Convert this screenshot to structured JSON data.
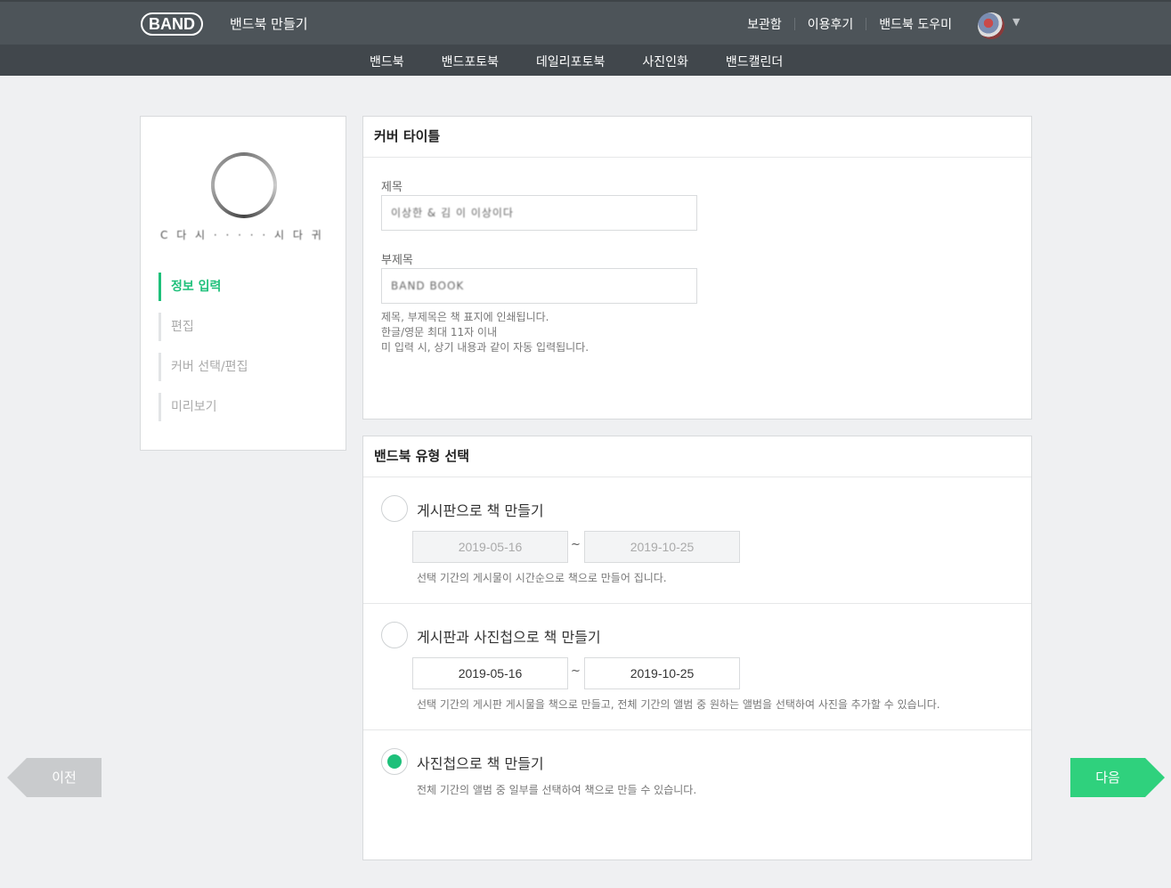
{
  "header": {
    "logo_text": "BAND",
    "app_title": "밴드북 만들기",
    "links": [
      "보관함",
      "이용후기",
      "밴드북 도우미"
    ],
    "caret": "▼"
  },
  "subnav": [
    "밴드북",
    "밴드포토북",
    "데일리포토북",
    "사진인화",
    "밴드캘린더"
  ],
  "sidebar": {
    "band_name": "C  다  시  ·  ·  ·  ·  ·  시  다  귀",
    "steps": [
      "정보 입력",
      "편집",
      "커버 선택/편집",
      "미리보기"
    ],
    "active_step": 0
  },
  "cover_title": {
    "section_title": "커버 타이틀",
    "title_label": "제목",
    "title_value": "이상한 & 김 이 이상이다",
    "subtitle_label": "부제목",
    "subtitle_value": "BAND BOOK",
    "hints": [
      "제목, 부제목은 책 표지에 인쇄됩니다.",
      "한글/영문 최대 11자 이내",
      "미 입력 시, 상기 내용과 같이 자동 입력됩니다."
    ]
  },
  "book_type": {
    "section_title": "밴드북 유형 선택",
    "options": [
      {
        "label": "게시판으로 책 만들기",
        "start": "2019-05-16",
        "end": "2019-10-25",
        "desc": "선택 기간의 게시물이 시간순으로 책으로 만들어 집니다.",
        "checked": false
      },
      {
        "label": "게시판과 사진첩으로 책 만들기",
        "start": "2019-05-16",
        "end": "2019-10-25",
        "desc": "선택 기간의 게시판 게시물을 책으로 만들고, 전체 기간의 앨범 중 원하는 앨범을 선택하여 사진을 추가할 수 있습니다.",
        "checked": false
      },
      {
        "label": "사진첩으로 책 만들기",
        "desc": "전체 기간의 앨범 중 일부를 선택하여 책으로 만들 수 있습니다.",
        "checked": true
      }
    ],
    "tilde": "~"
  },
  "nav": {
    "prev": "이전",
    "next": "다음"
  },
  "colors": {
    "accent": "#1ec07a",
    "next_button": "#2fd17d",
    "prev_button": "#c9cbcd",
    "header": "#4d5459"
  }
}
